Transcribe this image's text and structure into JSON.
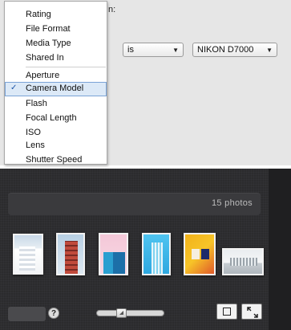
{
  "editor": {
    "fragment_label": "n:",
    "operator_value": "is",
    "value_value": "NIKON D7000"
  },
  "menu": {
    "group1": [
      "Rating",
      "File Format",
      "Media Type",
      "Shared In"
    ],
    "group2": [
      "Aperture",
      "Camera Model",
      "Flash",
      "Focal Length",
      "ISO",
      "Lens",
      "Shutter Speed"
    ],
    "selected": "Camera Model",
    "check_glyph": "✓"
  },
  "browser": {
    "photo_count": "15 photos",
    "help_label": "?"
  },
  "colors": {
    "selection_bg": "#dce9f7",
    "selection_border": "#7aa3d6",
    "dark_bg": "#2b2b2d"
  }
}
